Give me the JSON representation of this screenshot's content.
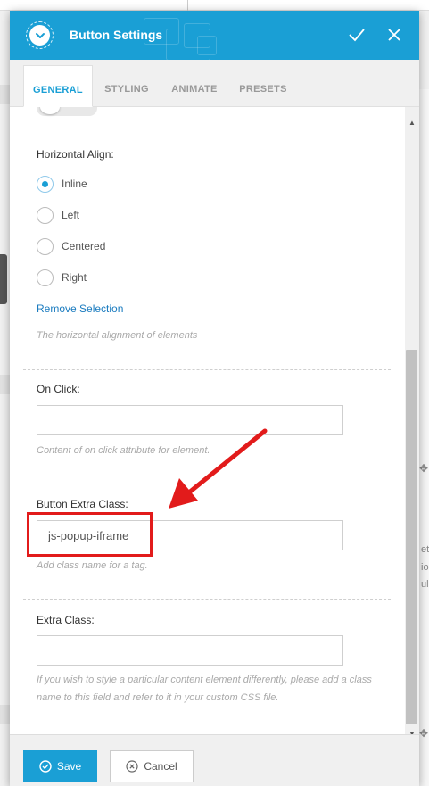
{
  "panel": {
    "title": "Button Settings"
  },
  "tabs": [
    {
      "label": "GENERAL",
      "active": true
    },
    {
      "label": "STYLING",
      "active": false
    },
    {
      "label": "ANIMATE",
      "active": false
    },
    {
      "label": "PRESETS",
      "active": false
    }
  ],
  "horizontal_align": {
    "label": "Horizontal Align:",
    "options": [
      "Inline",
      "Left",
      "Centered",
      "Right"
    ],
    "selected": "Inline",
    "remove_link": "Remove Selection",
    "help": "The horizontal alignment of elements"
  },
  "on_click": {
    "label": "On Click:",
    "value": "",
    "help": "Content of on click attribute for element."
  },
  "button_extra_class": {
    "label": "Button Extra Class:",
    "value": "js-popup-iframe",
    "help": "Add class name for a tag."
  },
  "extra_class": {
    "label": "Extra Class:",
    "value": "",
    "help": "If you wish to style a particular content element differently, please add a class name to this field and refer to it in your custom CSS file."
  },
  "footer": {
    "save_label": "Save",
    "cancel_label": "Cancel"
  },
  "background": {
    "right_fragments": [
      "et",
      "io",
      "ul"
    ]
  },
  "colors": {
    "accent": "#1a9fd5",
    "annotation": "#e21b1b",
    "link": "#1a7bbf"
  }
}
